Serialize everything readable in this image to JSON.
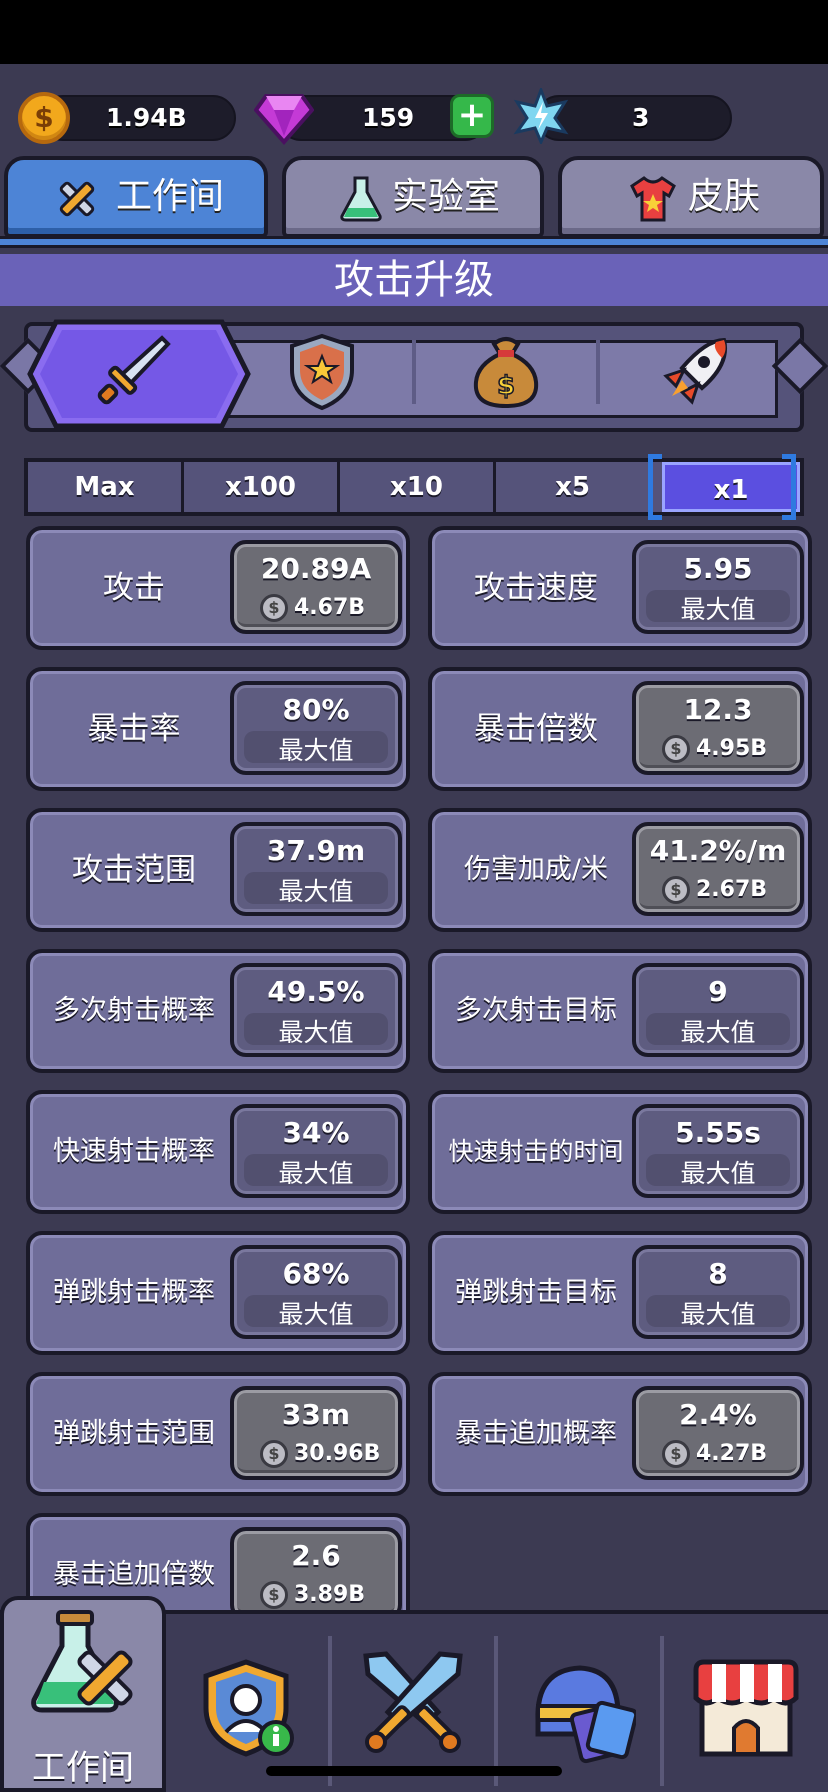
{
  "currencies": {
    "coins": "1.94B",
    "gems": "159",
    "stars": "3"
  },
  "tabs": [
    {
      "label": "工作间",
      "icon": "tools-icon",
      "active": true
    },
    {
      "label": "实验室",
      "icon": "flask-icon",
      "active": false
    },
    {
      "label": "皮肤",
      "icon": "shirt-icon",
      "active": false
    }
  ],
  "section_title": "攻击升级",
  "categories": [
    "sword-icon",
    "shield-icon",
    "money-bag-icon",
    "rocket-icon"
  ],
  "multipliers": [
    "Max",
    "x100",
    "x10",
    "x5",
    "x1"
  ],
  "active_multiplier": "x1",
  "upgrades": [
    {
      "name": "攻击",
      "value": "20.89A",
      "cost": "4.67B",
      "maxed": false
    },
    {
      "name": "攻击速度",
      "value": "5.95",
      "status": "最大值",
      "maxed": true
    },
    {
      "name": "暴击率",
      "value": "80%",
      "status": "最大值",
      "maxed": true
    },
    {
      "name": "暴击倍数",
      "value": "12.3",
      "cost": "4.95B",
      "maxed": false
    },
    {
      "name": "攻击范围",
      "value": "37.9m",
      "status": "最大值",
      "maxed": true
    },
    {
      "name": "伤害加成/米",
      "value": "41.2%/m",
      "cost": "2.67B",
      "maxed": false
    },
    {
      "name": "多次射击概率",
      "value": "49.5%",
      "status": "最大值",
      "maxed": true
    },
    {
      "name": "多次射击目标",
      "value": "9",
      "status": "最大值",
      "maxed": true
    },
    {
      "name": "快速射击概率",
      "value": "34%",
      "status": "最大值",
      "maxed": true
    },
    {
      "name": "快速射击的时间",
      "value": "5.55s",
      "status": "最大值",
      "maxed": true
    },
    {
      "name": "弹跳射击概率",
      "value": "68%",
      "status": "最大值",
      "maxed": true
    },
    {
      "name": "弹跳射击目标",
      "value": "8",
      "status": "最大值",
      "maxed": true
    },
    {
      "name": "弹跳射击范围",
      "value": "33m",
      "cost": "30.96B",
      "maxed": false
    },
    {
      "name": "暴击追加概率",
      "value": "2.4%",
      "cost": "4.27B",
      "maxed": false
    },
    {
      "name": "暴击追加倍数",
      "value": "2.6",
      "cost": "3.89B",
      "maxed": false
    }
  ],
  "coin_symbol": "$",
  "bottom_nav": [
    {
      "label": "工作间",
      "icon": "workshop-icon",
      "active": true
    },
    {
      "label": "",
      "icon": "profile-badge-icon",
      "active": false
    },
    {
      "label": "",
      "icon": "crossed-swords-icon",
      "active": false
    },
    {
      "label": "",
      "icon": "helmet-cards-icon",
      "active": false
    },
    {
      "label": "",
      "icon": "shop-icon",
      "active": false
    }
  ],
  "colors": {
    "active_tab": "#4d84d6",
    "section_bar": "#6a62b8",
    "active_multiplier": "#5b4fe0",
    "card": "#6f6d99",
    "gem": "#c43ad6",
    "coin": "#f2a81c"
  }
}
